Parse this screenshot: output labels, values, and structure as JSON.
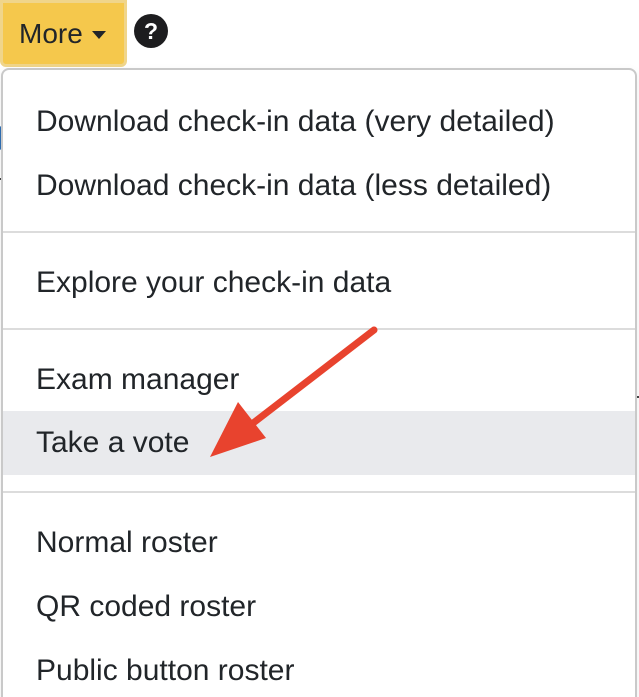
{
  "toolbar": {
    "more_label": "More",
    "help_label": "?"
  },
  "menu": {
    "items": [
      {
        "label": "Download check-in data (very detailed)"
      },
      {
        "label": "Download check-in data (less detailed)"
      },
      {
        "label": "Explore your check-in data"
      },
      {
        "label": "Exam manager"
      },
      {
        "label": "Take a vote"
      },
      {
        "label": "Normal roster"
      },
      {
        "label": "QR coded roster"
      },
      {
        "label": "Public button roster"
      }
    ],
    "highlighted_item": "Take a vote"
  },
  "annotation": {
    "icon": "arrow-icon",
    "color": "#e8432e",
    "points_to": "Take a vote"
  },
  "colors": {
    "button_bg": "#f5c84c",
    "highlight_bg": "#e9eaed"
  }
}
